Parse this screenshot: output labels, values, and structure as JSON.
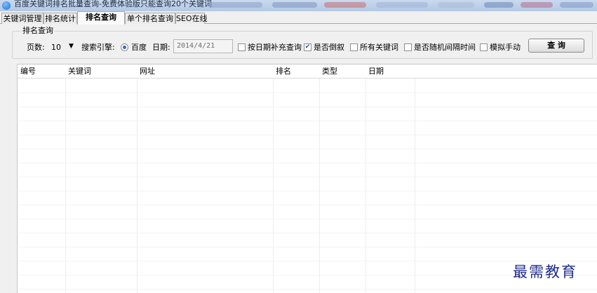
{
  "window": {
    "title": "百度关键词排名批量查询-免费体验版只能查询20个关键词"
  },
  "tabs": [
    {
      "label": "关键词管理",
      "active": false
    },
    {
      "label": "排名统计",
      "active": false
    },
    {
      "label": "排名查询",
      "active": true
    },
    {
      "label": "单个排名查询",
      "active": false
    },
    {
      "label": "SEO在线",
      "active": false
    }
  ],
  "query_group": {
    "title": "排名查询",
    "pages_label": "页数:",
    "pages_value": "10",
    "engine_label": "搜索引擎:",
    "engine_option": "百度",
    "engine_selected": true,
    "date_label": "日期:",
    "date_value": "2014/4/21",
    "options": [
      {
        "label": "按日期补充查询",
        "checked": false
      },
      {
        "label": "是否倒叙",
        "checked": true
      },
      {
        "label": "所有关键词",
        "checked": false
      },
      {
        "label": "是否随机间隔时间",
        "checked": false
      },
      {
        "label": "模拟手动",
        "checked": false
      }
    ],
    "query_button": "查 询"
  },
  "table": {
    "columns": [
      "编号",
      "关键词",
      "网址",
      "排名",
      "类型",
      "日期"
    ]
  },
  "watermark": "最需教育",
  "colors": {
    "title_bar": "#b9cde7",
    "accent": "#2b6fc4",
    "watermark": "#1f2c8c"
  }
}
